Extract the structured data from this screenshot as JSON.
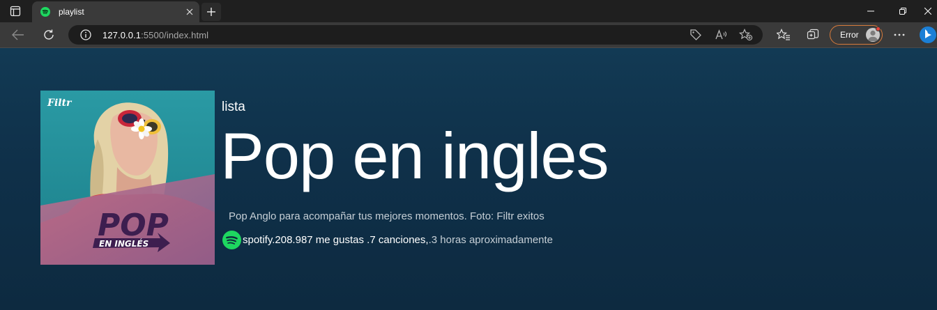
{
  "browser": {
    "tab": {
      "title": "playlist"
    },
    "address": {
      "host": "127.0.0.1",
      "rest": ":5500/index.html"
    },
    "profile": {
      "label": "Error"
    }
  },
  "playlist": {
    "type_label": "lista",
    "title": "Pop en ingles",
    "description": "Pop Anglo para acompañar tus mejores momentos. Foto: Filtr exitos",
    "owner": "spotify.",
    "likes": "208.987 me gustas .",
    "songs": "7 canciones, ",
    "duration": ".3 horas aproximadamente",
    "cover": {
      "brand": "Filtr",
      "line1": "POP",
      "line2": "EN INGLÉS"
    }
  },
  "colors": {
    "spotify_green": "#1ed760",
    "page_bg_top": "#123a54",
    "page_bg_bottom": "#0d2a40",
    "profile_border": "#d87b3b"
  },
  "icons": [
    "sidebar-icon",
    "spotify-icon",
    "close-icon",
    "plus-icon",
    "minimize-icon",
    "restore-icon",
    "window-close-icon",
    "back-icon",
    "refresh-icon",
    "info-icon",
    "tag-icon",
    "read-aloud-icon",
    "add-favorite-icon",
    "favorites-icon",
    "collections-icon",
    "more-icon",
    "bing-icon"
  ]
}
